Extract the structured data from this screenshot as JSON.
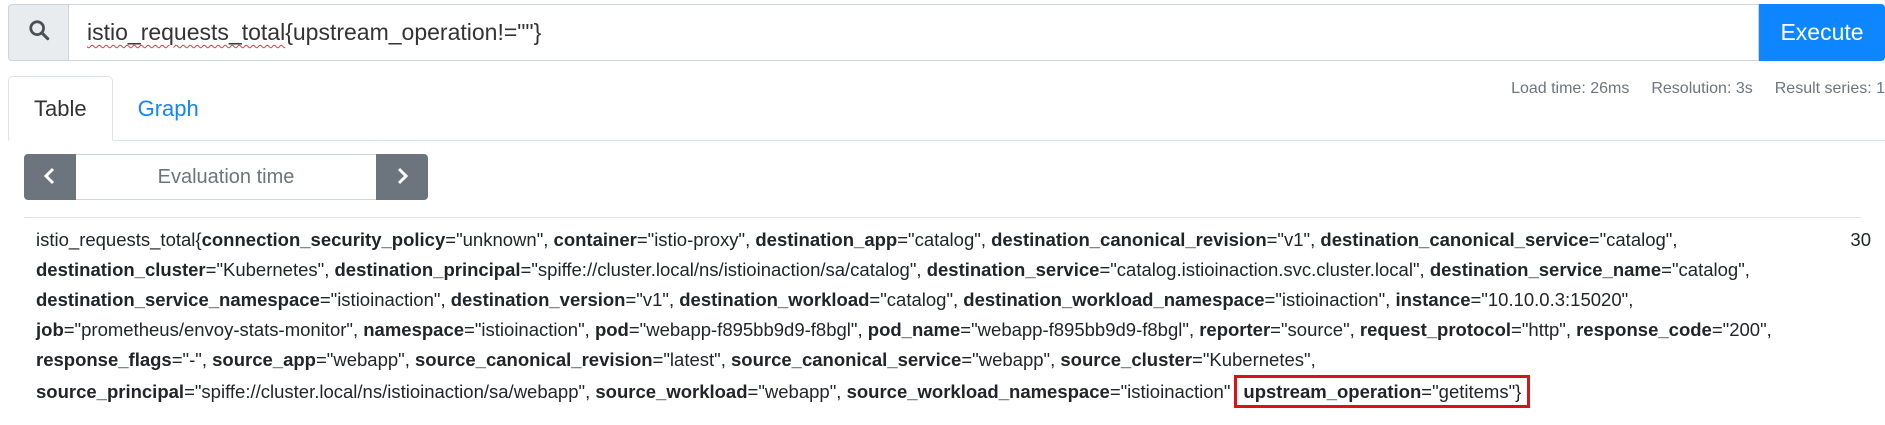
{
  "query": {
    "search_icon": "search-icon",
    "text_prefix": "istio_requests_total",
    "text_rest": "{upstream_operation!=\"\"}",
    "execute_label": "Execute"
  },
  "tabs": [
    {
      "label": "Table",
      "active": true
    },
    {
      "label": "Graph",
      "active": false
    }
  ],
  "stats": {
    "load_time": "Load time: 26ms",
    "resolution": "Resolution: 3s",
    "result_series": "Result series: 1"
  },
  "eval": {
    "prev_icon": "chevron-left-icon",
    "next_icon": "chevron-right-icon",
    "placeholder": "Evaluation time"
  },
  "result": {
    "metric_name": "istio_requests_total",
    "labels": [
      {
        "key": "connection_security_policy",
        "value": "unknown"
      },
      {
        "key": "container",
        "value": "istio-proxy"
      },
      {
        "key": "destination_app",
        "value": "catalog"
      },
      {
        "key": "destination_canonical_revision",
        "value": "v1"
      },
      {
        "key": "destination_canonical_service",
        "value": "catalog"
      },
      {
        "key": "destination_cluster",
        "value": "Kubernetes"
      },
      {
        "key": "destination_principal",
        "value": "spiffe://cluster.local/ns/istioinaction/sa/catalog"
      },
      {
        "key": "destination_service",
        "value": "catalog.istioinaction.svc.cluster.local"
      },
      {
        "key": "destination_service_name",
        "value": "catalog"
      },
      {
        "key": "destination_service_namespace",
        "value": "istioinaction"
      },
      {
        "key": "destination_version",
        "value": "v1"
      },
      {
        "key": "destination_workload",
        "value": "catalog"
      },
      {
        "key": "destination_workload_namespace",
        "value": "istioinaction"
      },
      {
        "key": "instance",
        "value": "10.10.0.3:15020"
      },
      {
        "key": "job",
        "value": "prometheus/envoy-stats-monitor"
      },
      {
        "key": "namespace",
        "value": "istioinaction"
      },
      {
        "key": "pod",
        "value": "webapp-f895bb9d9-f8bgl"
      },
      {
        "key": "pod_name",
        "value": "webapp-f895bb9d9-f8bgl"
      },
      {
        "key": "reporter",
        "value": "source"
      },
      {
        "key": "request_protocol",
        "value": "http"
      },
      {
        "key": "response_code",
        "value": "200"
      },
      {
        "key": "response_flags",
        "value": "-"
      },
      {
        "key": "source_app",
        "value": "webapp"
      },
      {
        "key": "source_canonical_revision",
        "value": "latest"
      },
      {
        "key": "source_canonical_service",
        "value": "webapp"
      },
      {
        "key": "source_cluster",
        "value": "Kubernetes"
      },
      {
        "key": "source_principal",
        "value": "spiffe://cluster.local/ns/istioinaction/sa/webapp"
      },
      {
        "key": "source_workload",
        "value": "webapp"
      },
      {
        "key": "source_workload_namespace",
        "value": "istioinaction"
      },
      {
        "key": "upstream_operation",
        "value": "getitems",
        "highlighted": true
      }
    ],
    "value": "30"
  },
  "colors": {
    "primary": "#0d86ff",
    "secondary": "#6c757d",
    "highlight_border": "#d7141a"
  }
}
